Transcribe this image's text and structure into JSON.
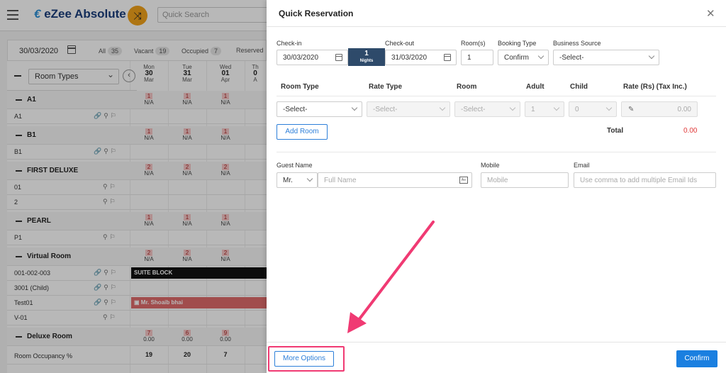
{
  "app": {
    "logo_text": "eZee Absolute",
    "search_placeholder": "Quick Search",
    "filter": {
      "date": "30/03/2020",
      "all_label": "All",
      "all_count": "35",
      "vacant_label": "Vacant",
      "vacant_count": "19",
      "occupied_label": "Occupied",
      "occupied_count": "7",
      "reserved_label": "Reserved"
    },
    "room_types_label": "Room Types",
    "days": [
      {
        "dow": "Mon",
        "day": "30",
        "mon": "Mar"
      },
      {
        "dow": "Tue",
        "day": "31",
        "mon": "Mar"
      },
      {
        "dow": "Wed",
        "day": "01",
        "mon": "Apr"
      },
      {
        "dow": "Th",
        "day": "0",
        "mon": "A"
      }
    ],
    "groups": {
      "a1": {
        "name": "A1",
        "counts": [
          "1",
          "1",
          "1"
        ],
        "na": "N/A"
      },
      "b1": {
        "name": "B1",
        "counts": [
          "1",
          "1",
          "1"
        ],
        "na": "N/A"
      },
      "first_deluxe": {
        "name": "FIRST DELUXE",
        "counts": [
          "2",
          "2",
          "2"
        ],
        "na": "N/A"
      },
      "pearl": {
        "name": "PEARL",
        "counts": [
          "1",
          "1",
          "1"
        ],
        "na": "N/A"
      },
      "virtual_room": {
        "name": "Virtual Room",
        "counts": [
          "2",
          "2",
          "2"
        ],
        "na": "N/A"
      },
      "deluxe_room": {
        "name": "Deluxe Room",
        "counts": [
          "7",
          "6",
          "9"
        ],
        "rates": [
          "0.00",
          "0.00",
          "0.00"
        ]
      }
    },
    "rooms": {
      "a1": "A1",
      "b1": "B1",
      "r01": "01",
      "r2": "2",
      "p1": "P1",
      "r001": "001-002-003",
      "r3001": "3001 (Child)",
      "test01": "Test01",
      "v01": "V-01"
    },
    "suite_block": "SUITE BLOCK",
    "reservation_guest": "Mr. Shoaib bhai",
    "occupancy_label": "Room Occupancy %",
    "occupancy": [
      "19",
      "20",
      "7"
    ]
  },
  "modal": {
    "title": "Quick Reservation",
    "checkin_label": "Check-in",
    "checkin_value": "30/03/2020",
    "checkout_label": "Check-out",
    "checkout_value": "31/03/2020",
    "nights_count": "1",
    "nights_label": "Nights",
    "rooms_label": "Room(s)",
    "rooms_value": "1",
    "booking_type_label": "Booking Type",
    "booking_type_value": "Confirm",
    "business_source_label": "Business Source",
    "business_source_value": "-Select-",
    "table_headers": {
      "room_type": "Room Type",
      "rate_type": "Rate Type",
      "room": "Room",
      "adult": "Adult",
      "child": "Child",
      "rate": "Rate (Rs)  (Tax Inc.)"
    },
    "row": {
      "room_type": "-Select-",
      "rate_type": "-Select-",
      "room": "-Select-",
      "adult": "1",
      "child": "0",
      "rate": "0.00"
    },
    "add_room_label": "Add Room",
    "total_label": "Total",
    "total_value": "0.00",
    "guest_name_label": "Guest Name",
    "salutation": "Mr.",
    "full_name_placeholder": "Full Name",
    "mobile_label": "Mobile",
    "mobile_placeholder": "Mobile",
    "email_label": "Email",
    "email_placeholder": "Use comma to add multiple Email Ids",
    "more_options_label": "More Options",
    "confirm_label": "Confirm"
  },
  "colors": {
    "primary": "#1a7fe0",
    "highlight": "#f03a73",
    "total": "#e03a3a",
    "nights_bg": "#2e4a6a"
  }
}
